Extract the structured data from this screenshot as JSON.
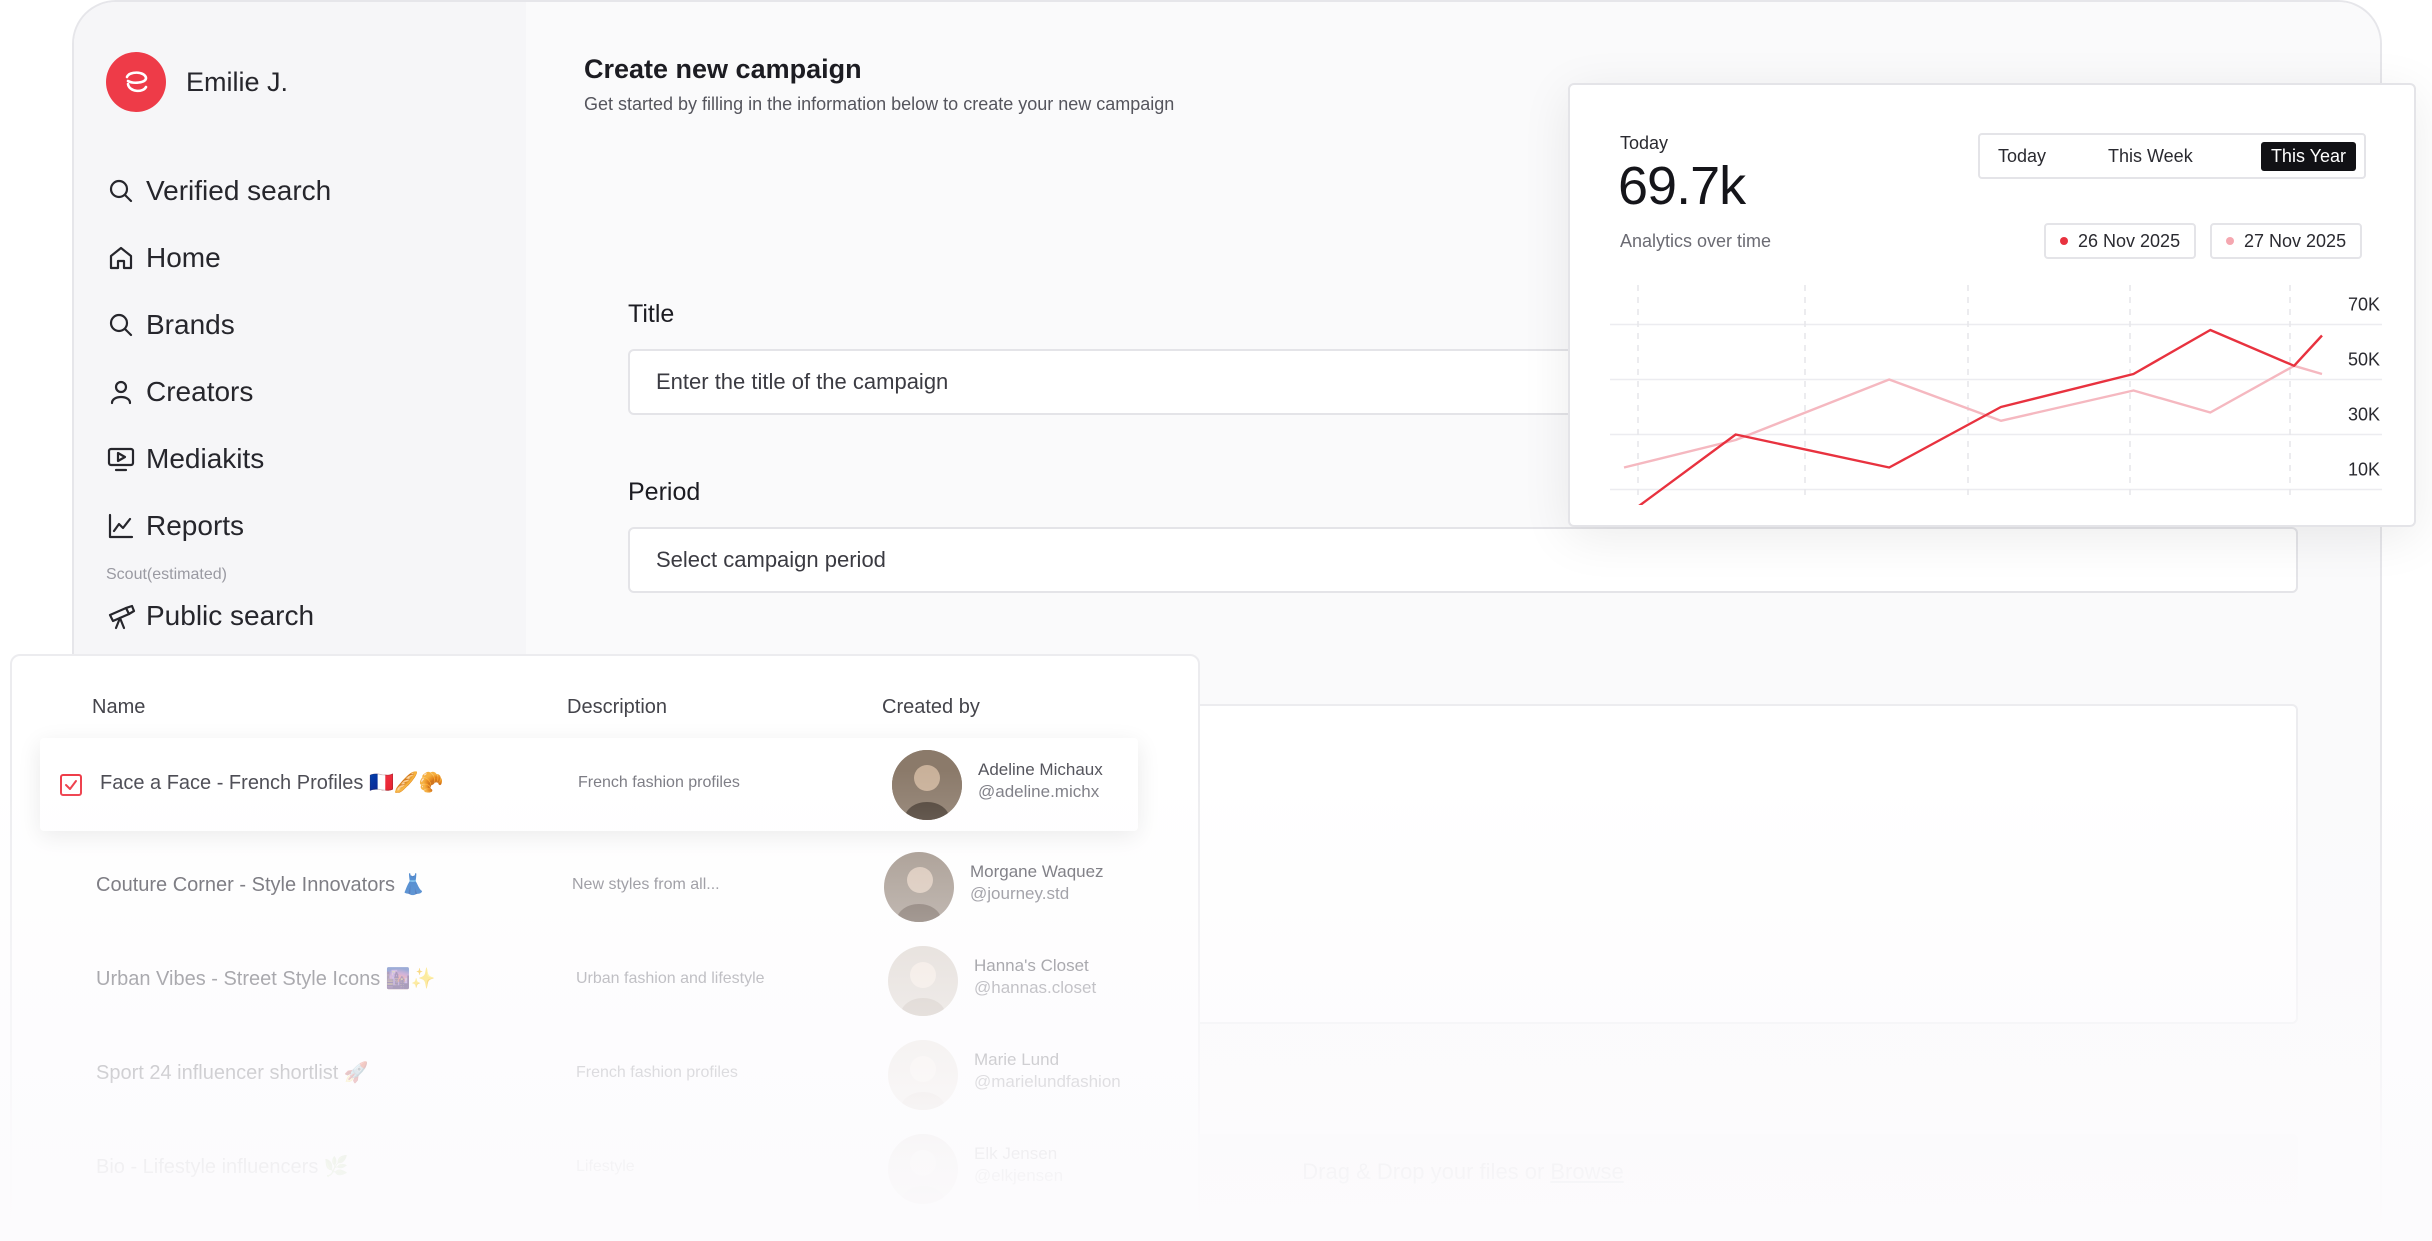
{
  "user": {
    "name": "Emilie J."
  },
  "sidebar": {
    "items": [
      {
        "label": "Verified search",
        "icon": "search-icon"
      },
      {
        "label": "Home",
        "icon": "home-icon"
      },
      {
        "label": "Brands",
        "icon": "search-icon"
      },
      {
        "label": "Creators",
        "icon": "user-icon"
      },
      {
        "label": "Mediakits",
        "icon": "monitor-play-icon"
      },
      {
        "label": "Reports",
        "icon": "line-chart-icon"
      }
    ],
    "section_label": "Scout(estimated)",
    "public_search": {
      "label": "Public search",
      "icon": "telescope-icon"
    }
  },
  "main": {
    "title": "Create new campaign",
    "subtitle": "Get started by filling in the information below to create your new campaign",
    "title_field": {
      "label": "Title",
      "placeholder": "Enter the title of the campaign"
    },
    "period_field": {
      "label": "Period",
      "placeholder": "Select campaign period"
    },
    "dropzone": {
      "text": "Drag & Drop your files or",
      "link": "Browse"
    }
  },
  "analytics": {
    "period_label": "Today",
    "value": "69.7k",
    "subtitle": "Analytics over time",
    "tabs": [
      "Today",
      "This Week",
      "This Year"
    ],
    "active_tab": "This Year",
    "dates": [
      {
        "label": "26 Nov 2025",
        "color": "#e8323f"
      },
      {
        "label": "27 Nov 2025",
        "color": "#f5a7b0"
      }
    ]
  },
  "chart_data": {
    "type": "line",
    "y_ticks": [
      "70K",
      "50K",
      "30K",
      "10K"
    ],
    "ylim": [
      0,
      80000
    ],
    "grid": true,
    "series": [
      {
        "color": "#e8323f",
        "values": [
          0,
          30000,
          18000,
          40000,
          52000,
          68000,
          55000,
          66000
        ]
      },
      {
        "color": "#f5b8c0",
        "values": [
          18000,
          28000,
          50000,
          35000,
          46000,
          38000,
          55000,
          52000
        ]
      }
    ],
    "x": [
      0,
      1,
      2,
      3,
      4,
      5,
      6,
      7
    ],
    "x_positions": [
      0,
      0.16,
      0.38,
      0.54,
      0.73,
      0.84,
      0.96,
      1.0
    ]
  },
  "campaigns": {
    "headers": {
      "name": "Name",
      "description": "Description",
      "created_by": "Created by"
    },
    "rows": [
      {
        "name": "Face a Face - French Profiles 🇫🇷🥖🥐",
        "description": "French fashion profiles",
        "person": "Adeline Michaux",
        "handle": "@adeline.michx",
        "avatar_color": "#8b7a6a"
      },
      {
        "name": "Couture Corner - Style Innovators 👗",
        "description": "New styles from all...",
        "person": "Morgane Waquez",
        "handle": "@journey.std",
        "avatar_color": "#9a8c80"
      },
      {
        "name": "Urban Vibes - Street Style Icons 🌆✨",
        "description": "Urban fashion and lifestyle",
        "person": "Hanna's Closet",
        "handle": "@hannas.closet",
        "avatar_color": "#d8cfc6"
      },
      {
        "name": "Sport 24 influencer shortlist 🚀",
        "description": "French fashion profiles",
        "person": "Marie Lund",
        "handle": "@marielundfashion",
        "avatar_color": "#e8e1da"
      },
      {
        "name": "Bio - Lifestyle influencers 🌿",
        "description": "Lifestyle",
        "person": "Elk Jensen",
        "handle": "@elkjensen",
        "avatar_color": "#cfc7c0"
      }
    ]
  }
}
